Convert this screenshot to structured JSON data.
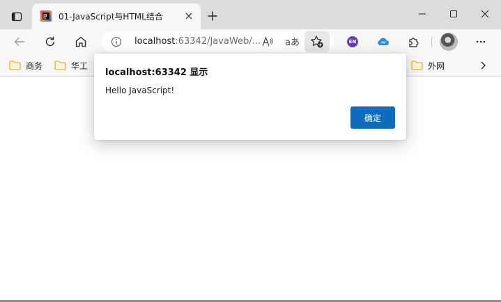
{
  "colors": {
    "titlebar_bg": "#dcdcdc",
    "toolbar_bg": "#f7f7f7",
    "accent": "#0f6cbd",
    "folder": "#f2c14e"
  },
  "tab": {
    "title": "01-JavaScript与HTML结合",
    "favicon": "jetbrains-icon"
  },
  "address_bar": {
    "host": "localhost",
    "path": ":63342/JavaWeb/...",
    "translate_label": "aあ"
  },
  "toolbar": {
    "extension_en_label": "EN"
  },
  "bookmarks": [
    {
      "label": "商务",
      "icon": "folder-icon"
    },
    {
      "label": "华工",
      "icon": "folder-icon"
    },
    {
      "label": "外网",
      "icon": "folder-icon"
    }
  ],
  "dialog": {
    "title": "localhost:63342 显示",
    "message": "Hello JavaScript!",
    "ok_label": "确定"
  }
}
